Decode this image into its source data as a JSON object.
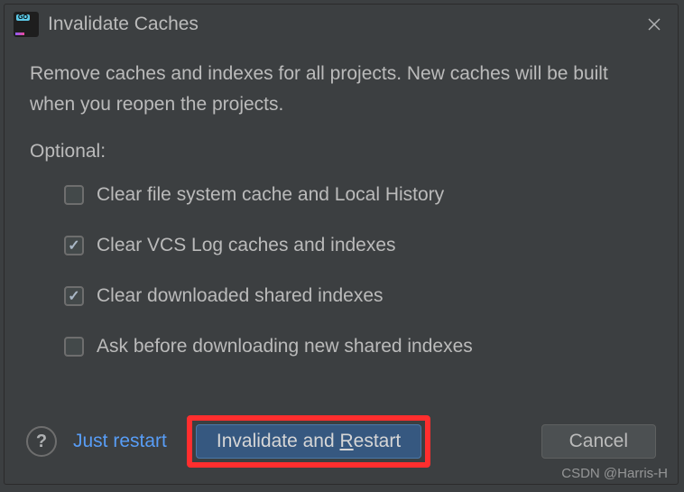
{
  "dialog": {
    "title": "Invalidate Caches",
    "description": "Remove caches and indexes for all projects. New caches will be built when you reopen the projects.",
    "optional_label": "Optional:",
    "options": [
      {
        "label": "Clear file system cache and Local History",
        "checked": false
      },
      {
        "label": "Clear VCS Log caches and indexes",
        "checked": true
      },
      {
        "label": "Clear downloaded shared indexes",
        "checked": true
      },
      {
        "label": "Ask before downloading new shared indexes",
        "checked": false
      }
    ],
    "buttons": {
      "help": "?",
      "just_restart": "Just restart",
      "primary_pre": "Invalidate and ",
      "primary_mnemonic": "R",
      "primary_post": "estart",
      "cancel": "Cancel"
    }
  },
  "watermark": "CSDN @Harris-H"
}
